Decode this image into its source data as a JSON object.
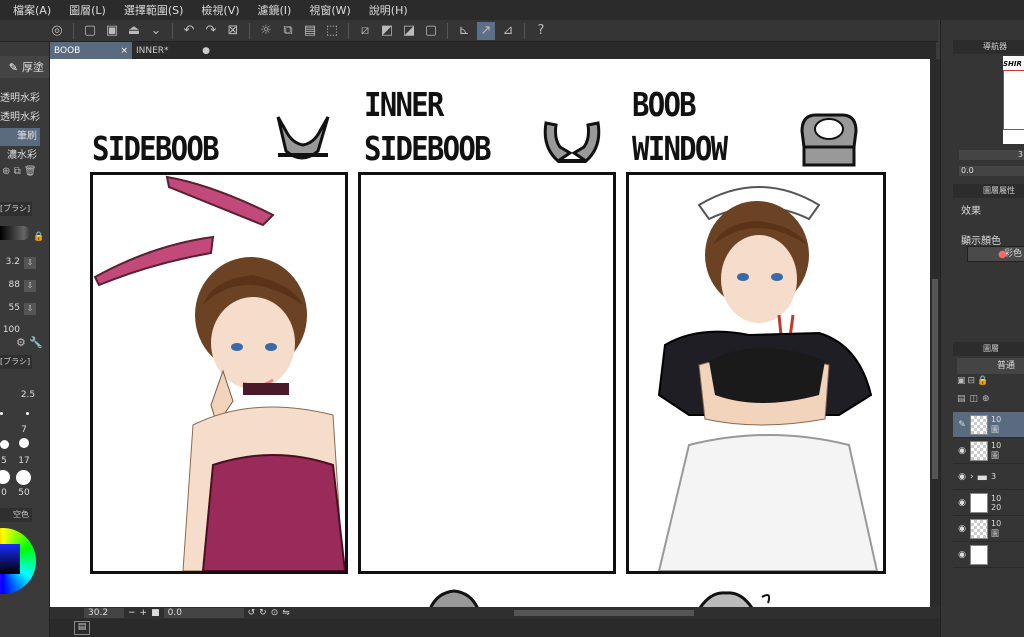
{
  "menu": [
    "檔案(A)",
    "圖層(L)",
    "選擇範圍(S)",
    "檢視(V)",
    "濾鏡(I)",
    "視窗(W)",
    "說明(H)"
  ],
  "tabs": [
    {
      "label": "BOOB",
      "close": "×"
    },
    {
      "label": "INNER*",
      "close": "●"
    }
  ],
  "left_panel": {
    "header": "厚塗",
    "brushes": [
      "透明水彩",
      "透明水彩",
      "筆刷",
      "濃水彩"
    ],
    "section_label": "[ブラシ]",
    "section_label2": "[ブラシ]",
    "values": [
      "3.2",
      "88",
      "55",
      "100"
    ],
    "brush_sizes": [
      "2.5",
      "7",
      "17",
      "50"
    ],
    "brush_size_left": [
      "5",
      "0"
    ],
    "bottom_label": "空色"
  },
  "canvas": {
    "panels": [
      {
        "title_lines": [
          "SIDEBOOB"
        ]
      },
      {
        "title_lines": [
          "INNER",
          "SIDEBOOB"
        ]
      },
      {
        "title_lines": [
          "BOOB",
          "WINDOW"
        ]
      }
    ]
  },
  "status": {
    "zoom": "30.2",
    "minus": "−",
    "plus": "+",
    "angle": "0.0"
  },
  "right_panel": {
    "navigator_title": "導航器",
    "navigator_preview_text": "SHIR",
    "nav_value1": "3",
    "nav_value2": "0.0",
    "props_title": "圖層屬性",
    "effects_label": "效果",
    "display_color_label": "顯示顏色",
    "color_button": "彩色",
    "layer_tab": "圖層",
    "blend_mode": "普通",
    "layers": [
      {
        "name": "10",
        "name2": "圖",
        "visible": false,
        "selected": true,
        "thumb": "checker"
      },
      {
        "name": "10",
        "name2": "圖",
        "visible": true,
        "selected": false,
        "thumb": "checker"
      },
      {
        "name": "3",
        "name2": "",
        "visible": true,
        "selected": false,
        "thumb": "folder"
      },
      {
        "name": "10",
        "name2": "20",
        "visible": true,
        "selected": false,
        "thumb": "white"
      },
      {
        "name": "10",
        "name2": "圖",
        "visible": true,
        "selected": false,
        "thumb": "checker"
      },
      {
        "name": "",
        "name2": "",
        "visible": true,
        "selected": false,
        "thumb": "white"
      }
    ]
  },
  "colors": {
    "app_bg": "#3b3b3b",
    "accent": "#5a6b80"
  }
}
